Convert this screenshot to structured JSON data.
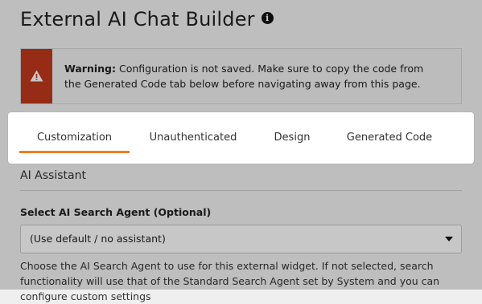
{
  "page": {
    "title": "External AI Chat Builder",
    "info_icon": "info-icon"
  },
  "warning": {
    "icon": "warning-triangle-icon",
    "color": "#c0391b",
    "label": "Warning:",
    "text": "Configuration is not saved. Make sure to copy the code from the Generated Code tab below before navigating away from this page."
  },
  "tabs": [
    {
      "label": "Customization",
      "active": true
    },
    {
      "label": "Unauthenticated",
      "active": false
    },
    {
      "label": "Design",
      "active": false
    },
    {
      "label": "Generated Code",
      "active": false
    }
  ],
  "accent_color": "#ef7d22",
  "section": {
    "title": "AI Assistant"
  },
  "agent_field": {
    "label": "Select AI Search Agent (Optional)",
    "value": "(Use default / no assistant)",
    "help": "Choose the AI Search Agent to use for this external widget. If not selected, search functionality will use that of the Standard Search Agent set by System and you can configure custom settings"
  }
}
